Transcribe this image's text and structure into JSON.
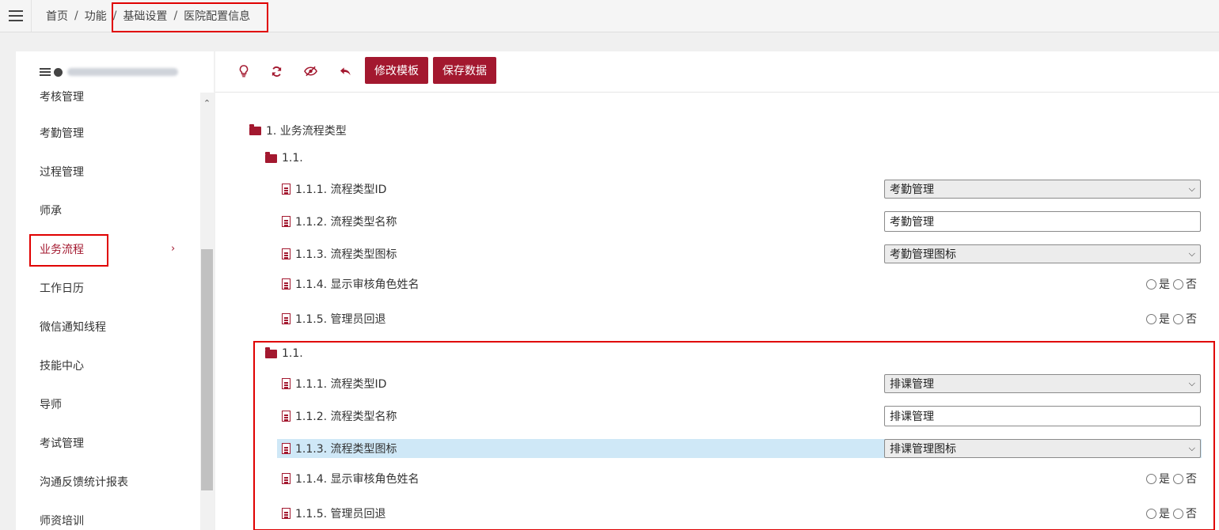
{
  "breadcrumb": {
    "items": [
      "首页",
      "功能",
      "基础设置",
      "医院配置信息"
    ],
    "separator": "/"
  },
  "sidebar": {
    "items": [
      {
        "label": "考核管理"
      },
      {
        "label": "考勤管理"
      },
      {
        "label": "过程管理"
      },
      {
        "label": "师承"
      },
      {
        "label": "业务流程",
        "active": true,
        "chevron": "›"
      },
      {
        "label": "工作日历"
      },
      {
        "label": "微信通知线程"
      },
      {
        "label": "技能中心"
      },
      {
        "label": "导师"
      },
      {
        "label": "考试管理"
      },
      {
        "label": "沟通反馈统计报表"
      },
      {
        "label": "师资培训"
      }
    ]
  },
  "toolbar": {
    "icons": [
      "lightbulb-icon",
      "refresh-icon",
      "eye-slash-icon",
      "undo-icon"
    ],
    "edit_template_label": "修改模板",
    "save_data_label": "保存数据"
  },
  "tree": {
    "root_label": "1. 业务流程类型",
    "groups": [
      {
        "label": "1.1.",
        "rows": [
          {
            "label": "1.1.1. 流程类型ID",
            "type": "select",
            "value": "考勤管理"
          },
          {
            "label": "1.1.2. 流程类型名称",
            "type": "input",
            "value": "考勤管理"
          },
          {
            "label": "1.1.3. 流程类型图标",
            "type": "select",
            "value": "考勤管理图标"
          },
          {
            "label": "1.1.4. 显示审核角色姓名",
            "type": "radio",
            "yes": "是",
            "no": "否"
          },
          {
            "label": "1.1.5. 管理员回退",
            "type": "radio",
            "yes": "是",
            "no": "否"
          }
        ]
      },
      {
        "label": "1.1.",
        "rows": [
          {
            "label": "1.1.1. 流程类型ID",
            "type": "select",
            "value": "排课管理"
          },
          {
            "label": "1.1.2. 流程类型名称",
            "type": "input",
            "value": "排课管理"
          },
          {
            "label": "1.1.3. 流程类型图标",
            "type": "select",
            "value": "排课管理图标",
            "selected": true
          },
          {
            "label": "1.1.4. 显示审核角色姓名",
            "type": "radio",
            "yes": "是",
            "no": "否"
          },
          {
            "label": "1.1.5. 管理员回退",
            "type": "radio",
            "yes": "是",
            "no": "否"
          }
        ]
      }
    ]
  },
  "colors": {
    "accent": "#a3182f",
    "highlight_border": "#e00000",
    "selected_row": "#cfe8f7"
  }
}
